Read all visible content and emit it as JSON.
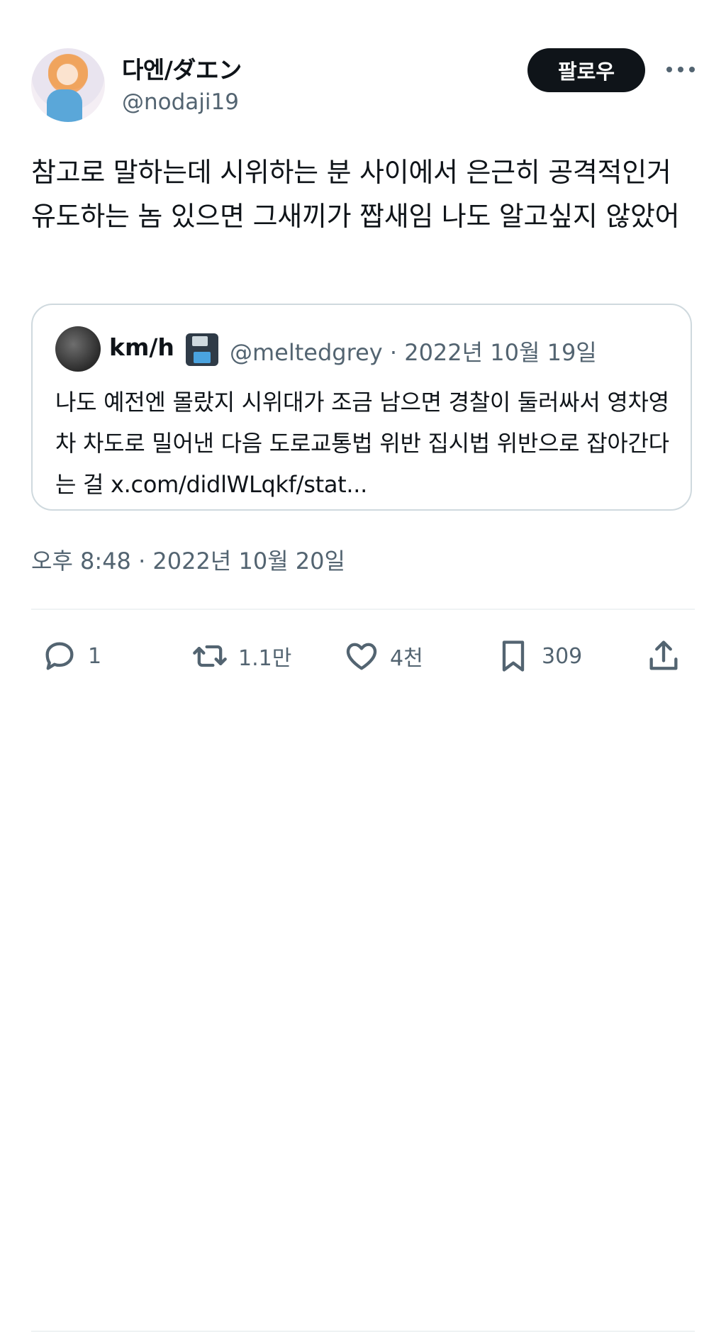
{
  "author": {
    "display_name": "다엔/ダエン",
    "handle": "@nodaji19",
    "follow_label": "팔로우",
    "more_icon": "more-horizontal-icon"
  },
  "tweet": {
    "text": "참고로 말하는데 시위하는 분 사이에서 은근히 공격적인거 유도하는 놈 있으면 그새끼가 짭새임 나도 알고싶지 않았어",
    "timestamp": "오후 8:48 · 2022년 10월 20일"
  },
  "quoted": {
    "name": "km/h",
    "emoji": "floppy-disk-icon",
    "meta": "@meltedgrey · 2022년 10월 19일",
    "text": "나도 예전엔 몰랐지 시위대가 조금 남으면 경찰이 둘러싸서 영차영차 차도로 밀어낸 다음 도로교통법 위반 집시법 위반으로 잡아간다는 걸 x.com/didlWLqkf/stat..."
  },
  "actions": {
    "reply_count": "1",
    "retweet_count": "1.1만",
    "like_count": "4천",
    "bookmark_count": "309"
  },
  "colors": {
    "text": "#0f1419",
    "muted": "#536471",
    "border": "#cfd9de",
    "follow_bg": "#0f1419"
  }
}
